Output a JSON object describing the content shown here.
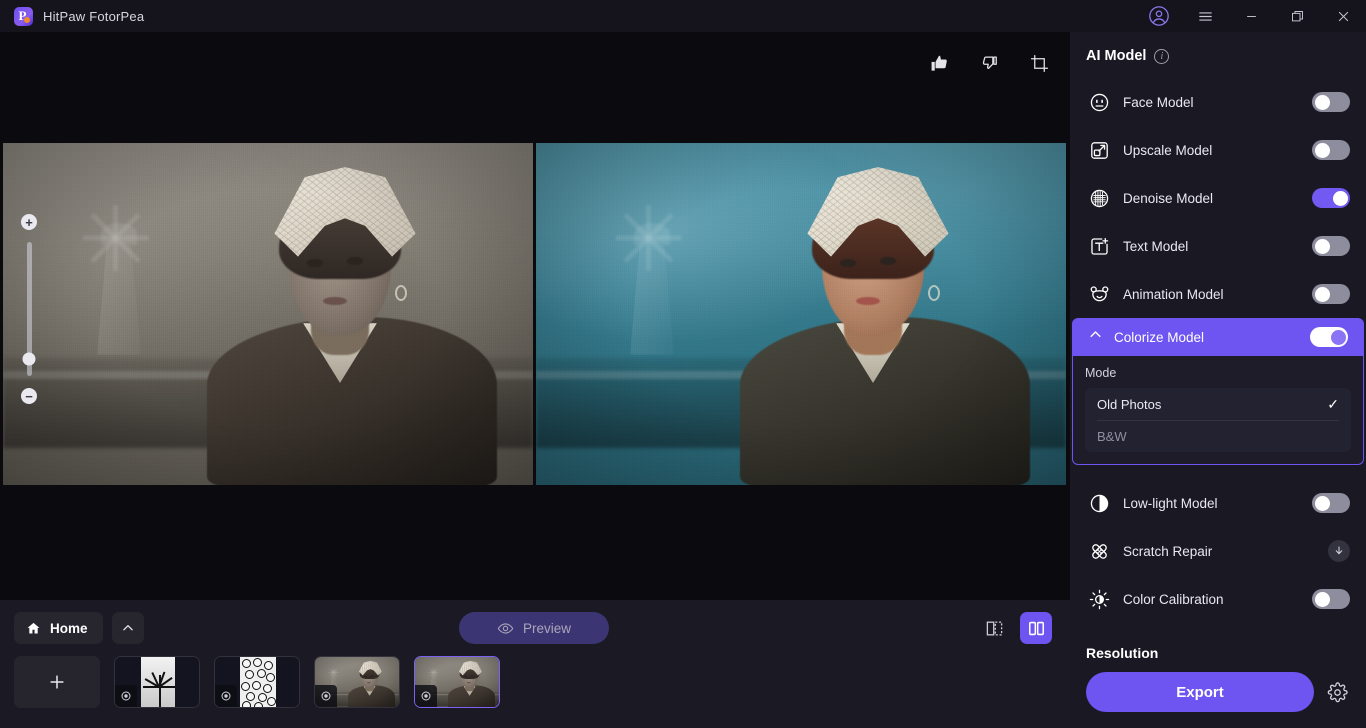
{
  "titlebar": {
    "app_name": "HitPaw FotorPea",
    "logo_glyph": "P",
    "controls": [
      {
        "name": "account-icon",
        "label": "account"
      },
      {
        "name": "menu-icon",
        "label": "menu"
      },
      {
        "name": "minimize-icon",
        "label": "minimize"
      },
      {
        "name": "maximize-icon",
        "label": "maximize"
      },
      {
        "name": "close-icon",
        "label": "close"
      }
    ]
  },
  "canvas": {
    "tools": [
      {
        "name": "thumbs-up-icon",
        "label": "Like"
      },
      {
        "name": "thumbs-down-icon",
        "label": "Dislike"
      },
      {
        "name": "crop-icon",
        "label": "Crop"
      }
    ],
    "zoom": {
      "plus": "+",
      "minus": "−"
    }
  },
  "bottombar": {
    "home_label": "Home",
    "collapse_label": "Collapse",
    "preview_label": "Preview",
    "add_label": "+",
    "view_modes": [
      {
        "name": "split-view-icon",
        "label": "Split view",
        "active": false
      },
      {
        "name": "side-by-side-view-icon",
        "label": "Side by side view",
        "active": true
      }
    ],
    "thumbnails": [
      {
        "name": "thumbnail-palm",
        "label": "Palm tree photo",
        "selected": false
      },
      {
        "name": "thumbnail-clocks",
        "label": "Clocks photo",
        "selected": false
      },
      {
        "name": "thumbnail-portrait-1",
        "label": "Vintage portrait",
        "selected": false
      },
      {
        "name": "thumbnail-portrait-2",
        "label": "Vintage portrait",
        "selected": true
      }
    ]
  },
  "panel": {
    "title": "AI Model",
    "info_glyph": "i",
    "models": [
      {
        "label": "Face Model",
        "icon": "face-model-icon",
        "toggle": "off"
      },
      {
        "label": "Upscale Model",
        "icon": "upscale-model-icon",
        "toggle": "off"
      },
      {
        "label": "Denoise Model",
        "icon": "denoise-model-icon",
        "toggle": "on"
      },
      {
        "label": "Text Model",
        "icon": "text-model-icon",
        "toggle": "off"
      },
      {
        "label": "Animation Model",
        "icon": "animation-model-icon",
        "toggle": "off"
      }
    ],
    "colorize": {
      "label": "Colorize Model",
      "expanded": true,
      "toggle": "on",
      "mode_label": "Mode",
      "options": [
        {
          "label": "Old Photos",
          "selected": true,
          "check": "✓"
        },
        {
          "label": "B&W",
          "selected": false,
          "check": ""
        }
      ]
    },
    "models_after": [
      {
        "label": "Low-light Model",
        "icon": "low-light-model-icon",
        "toggle": "off"
      },
      {
        "label": "Scratch Repair",
        "icon": "scratch-repair-icon",
        "toggle": "download"
      },
      {
        "label": "Color Calibration",
        "icon": "color-calibration-icon",
        "toggle": "off"
      }
    ],
    "resolution_label": "Resolution",
    "export_label": "Export",
    "settings_label": "Export settings"
  },
  "colors": {
    "accent": "#6e54f0",
    "accent_light": "#7159f2",
    "panel_bg": "#191823",
    "canvas_bg": "#0b0b0f",
    "bottombar_bg": "#1b1a24",
    "titlebar_bg": "#15141c",
    "toggle_off": "#8d8d9e"
  }
}
